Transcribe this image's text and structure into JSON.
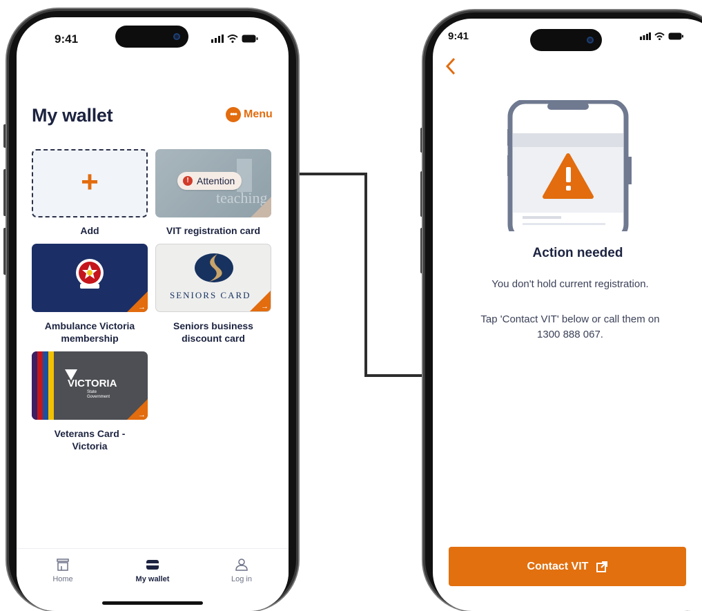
{
  "left_screen": {
    "status": {
      "time": "9:41"
    },
    "header": {
      "title": "My wallet",
      "menu_label": "Menu",
      "menu_icon": "more-dots-icon"
    },
    "cards": [
      {
        "label": "Add",
        "icon": "plus-icon"
      },
      {
        "label": "VIT registration card",
        "badge": "Attention",
        "card_text": "teaching"
      },
      {
        "label": "Ambulance Victoria membership",
        "label_lines": [
          "Ambulance Victoria",
          "membership"
        ]
      },
      {
        "label": "Seniors business discount card",
        "label_lines": [
          "Seniors business",
          "discount card"
        ],
        "card_text": "SENIORS CARD"
      },
      {
        "label": "Veterans Card - Victoria",
        "label_lines": [
          "Veterans Card -",
          "Victoria"
        ],
        "card_text": "VICTORIA",
        "card_subtext_1": "State",
        "card_subtext_2": "Government"
      }
    ],
    "nav": [
      {
        "label": "Home",
        "icon": "home-icon"
      },
      {
        "label": "My wallet",
        "icon": "wallet-icon",
        "active": true
      },
      {
        "label": "Log in",
        "icon": "user-icon"
      }
    ]
  },
  "right_screen": {
    "status": {
      "time": "9:41"
    },
    "back_icon": "chevron-left-icon",
    "title": "Action needed",
    "message_1": "You don't hold current registration.",
    "message_2_line1": "Tap 'Contact VIT' below or call them on",
    "message_2_line2": "1300 888 067.",
    "cta_label": "Contact VIT",
    "cta_icon": "external-link-icon"
  },
  "colors": {
    "accent": "#e26c0e",
    "navy": "#1c2340",
    "ambulance_blue": "#1b2f66",
    "veterans_grey": "#4d4f54"
  }
}
